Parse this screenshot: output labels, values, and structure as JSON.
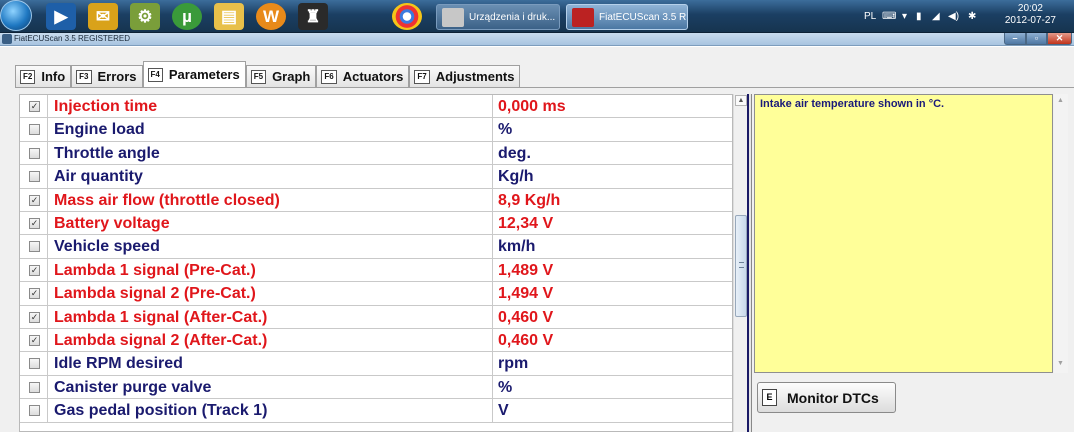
{
  "taskbar": {
    "tasks": [
      {
        "label": "Urządzenia i druk..."
      },
      {
        "label": "FiatECUScan 3.5 R..."
      }
    ],
    "tray": {
      "language": "PL",
      "time": "20:02",
      "date": "2012-07-27"
    }
  },
  "window": {
    "title": "FiatECUScan 3.5 REGISTERED"
  },
  "tabs": [
    {
      "key": "F2",
      "label": "Info"
    },
    {
      "key": "F3",
      "label": "Errors"
    },
    {
      "key": "F4",
      "label": "Parameters",
      "active": true
    },
    {
      "key": "F5",
      "label": "Graph"
    },
    {
      "key": "F6",
      "label": "Actuators"
    },
    {
      "key": "F7",
      "label": "Adjustments"
    }
  ],
  "parameters": [
    {
      "checked": true,
      "name": "Injection time",
      "value": "0,000 ms"
    },
    {
      "checked": false,
      "name": "Engine load",
      "value": "%"
    },
    {
      "checked": false,
      "name": "Throttle angle",
      "value": "deg."
    },
    {
      "checked": false,
      "name": "Air quantity",
      "value": "Kg/h"
    },
    {
      "checked": true,
      "name": "Mass air flow (throttle closed)",
      "value": "8,9 Kg/h"
    },
    {
      "checked": true,
      "name": "Battery voltage",
      "value": "12,34 V"
    },
    {
      "checked": false,
      "name": "Vehicle speed",
      "value": "km/h"
    },
    {
      "checked": true,
      "name": "Lambda 1 signal (Pre-Cat.)",
      "value": "1,489 V"
    },
    {
      "checked": true,
      "name": "Lambda signal 2 (Pre-Cat.)",
      "value": "1,494 V"
    },
    {
      "checked": true,
      "name": "Lambda 1 signal (After-Cat.)",
      "value": "0,460 V"
    },
    {
      "checked": true,
      "name": "Lambda signal 2 (After-Cat.)",
      "value": "0,460 V"
    },
    {
      "checked": false,
      "name": "Idle RPM desired",
      "value": "rpm"
    },
    {
      "checked": false,
      "name": "Canister purge valve",
      "value": "%"
    },
    {
      "checked": false,
      "name": "Gas pedal position (Track 1)",
      "value": "V"
    }
  ],
  "colors": {
    "active_param": "#e0161b",
    "inactive_param": "#1a1a6e",
    "info_bg": "#ffff99"
  },
  "info_panel": {
    "text": "Intake air temperature shown in °C."
  },
  "monitor_button": {
    "key": "E",
    "label": "Monitor DTCs"
  }
}
